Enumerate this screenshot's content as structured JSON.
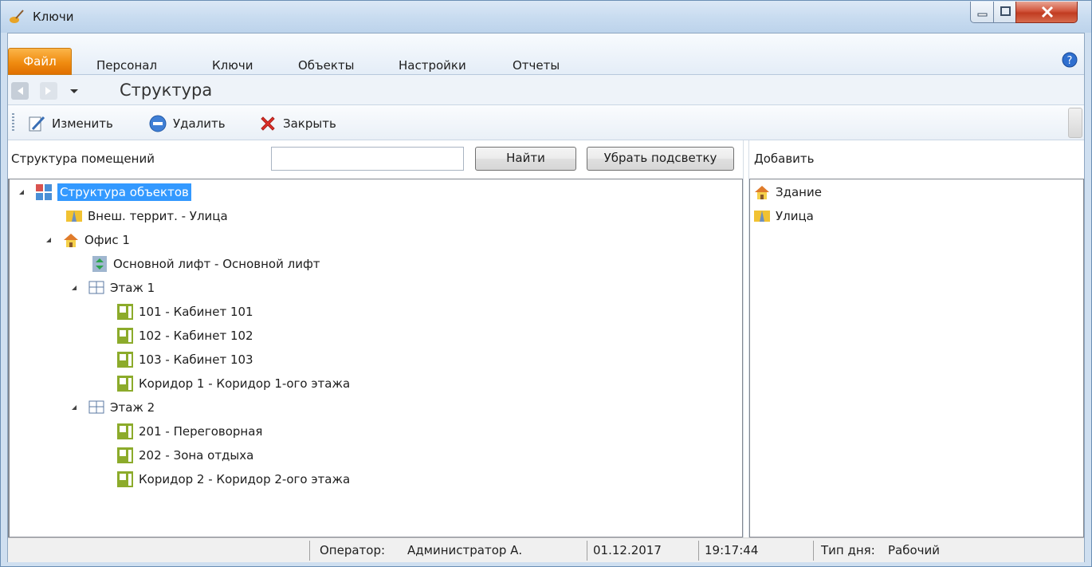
{
  "window": {
    "title": "Ключи"
  },
  "menu": {
    "file_label": "Файл",
    "tabs": [
      "Персонал",
      "Ключи",
      "Объекты",
      "Настройки",
      "Отчеты"
    ]
  },
  "nav": {
    "page_title": "Структура"
  },
  "toolbar": {
    "edit_label": "Изменить",
    "delete_label": "Удалить",
    "close_label": "Закрыть"
  },
  "search": {
    "panel_label": "Структура помещений",
    "value": "",
    "find_label": "Найти",
    "clear_label": "Убрать подсветку"
  },
  "tree": {
    "root": "Структура объектов",
    "street": "Внеш. террит. - Улица",
    "office": "Офис 1",
    "lift": "Основной лифт - Основной лифт",
    "floor1": "Этаж 1",
    "room101": "101 - Кабинет 101",
    "room102": "102 - Кабинет 102",
    "room103": "103 - Кабинет 103",
    "corridor1": "Коридор 1 - Коридор 1-ого этажа",
    "floor2": "Этаж 2",
    "room201": "201 - Переговорная",
    "room202": "202 - Зона отдыха",
    "corridor2": "Коридор 2 - Коридор 2-ого этажа"
  },
  "add_panel": {
    "label": "Добавить",
    "items": [
      "Здание",
      "Улица"
    ]
  },
  "status": {
    "operator_label": "Оператор:",
    "operator": "Администратор А.",
    "date": "01.12.2017",
    "time": "19:17:44",
    "daytype_label": "Тип дня:",
    "daytype": "Рабочий"
  },
  "colors": {
    "accent_orange": "#f08c10",
    "selection_blue": "#3399ff",
    "close_red": "#c13c21"
  },
  "icons": [
    "broom-icon",
    "help-icon",
    "back-arrow-icon",
    "forward-arrow-icon",
    "dropdown-icon",
    "edit-icon",
    "delete-icon",
    "close-x-icon",
    "structure-icon",
    "street-icon",
    "building-icon",
    "lift-icon",
    "floor-icon",
    "room-icon"
  ]
}
